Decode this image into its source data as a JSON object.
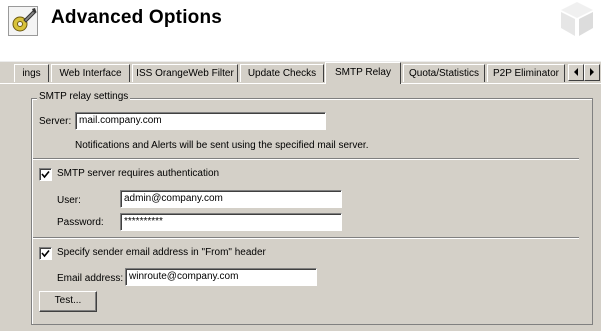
{
  "header": {
    "title": "Advanced Options",
    "icon": "wrench-settings-icon",
    "watermark_icon": "cube-watermark-icon"
  },
  "tabs": [
    {
      "label": "ings",
      "active": false
    },
    {
      "label": "Web Interface",
      "active": false
    },
    {
      "label": "ISS OrangeWeb Filter",
      "active": false
    },
    {
      "label": "Update Checks",
      "active": false
    },
    {
      "label": "SMTP Relay",
      "active": true
    },
    {
      "label": "Quota/Statistics",
      "active": false
    },
    {
      "label": "P2P Eliminator",
      "active": false
    }
  ],
  "tab_scroll": {
    "left_icon": "arrow-left-icon",
    "right_icon": "arrow-right-icon"
  },
  "smtp": {
    "group_title": "SMTP relay settings",
    "server_label": "Server:",
    "server_value": "mail.company.com",
    "server_note": "Notifications and Alerts will be sent using the specified mail server.",
    "auth_checkbox_label": "SMTP server requires authentication",
    "auth_checked": true,
    "user_label": "User:",
    "user_value": "admin@company.com",
    "password_label": "Password:",
    "password_value": "**********",
    "from_checkbox_label": "Specify sender email address in \"From\" header",
    "from_checked": true,
    "email_label": "Email address:",
    "email_value": "winroute@company.com",
    "test_button": "Test..."
  },
  "colors": {
    "panel": "#d4d0c8",
    "background": "#ffffff"
  }
}
